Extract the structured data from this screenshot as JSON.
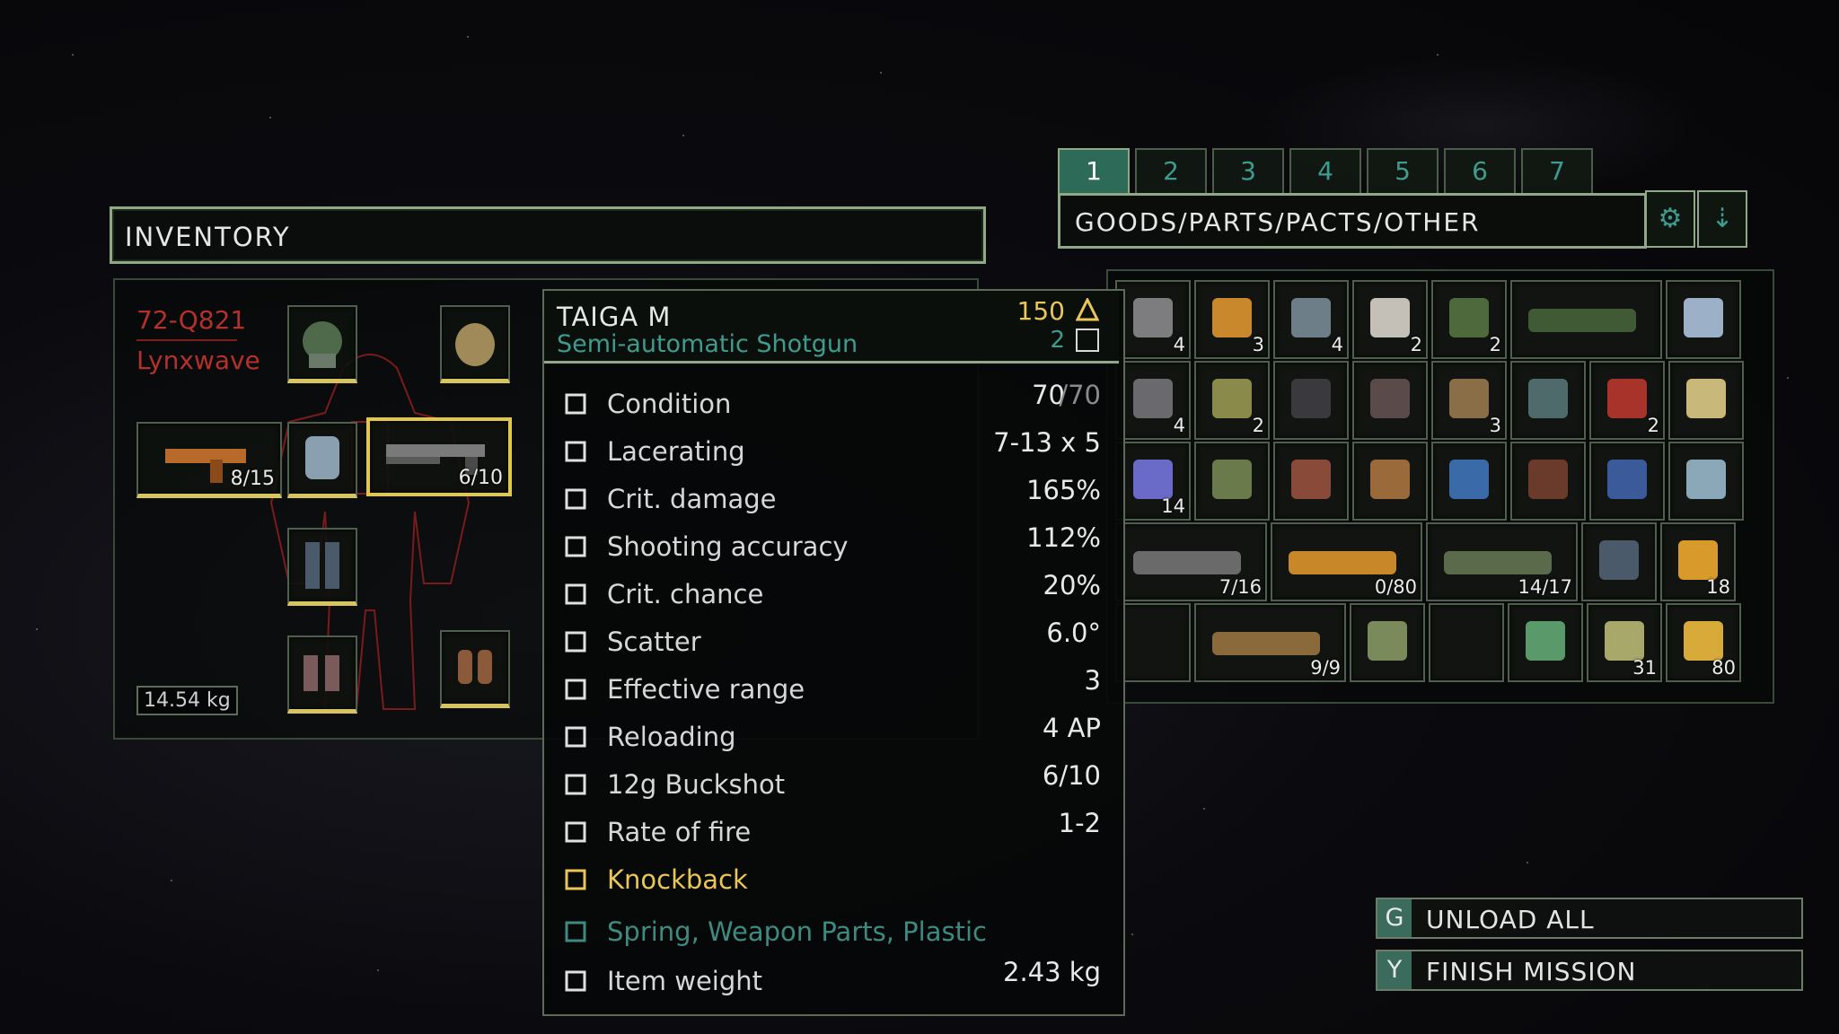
{
  "inventory": {
    "title": "INVENTORY",
    "character_id": "72-Q821",
    "character_name": "Lynxwave",
    "weight": "14.54 kg",
    "slots": {
      "left_weapon_qty": "8/15",
      "right_weapon_qty": "6/10"
    }
  },
  "tooltip": {
    "name": "TAIGA M",
    "type": "Semi-automatic Shotgun",
    "price": "150",
    "count": "2",
    "stats": [
      {
        "icon": "condition-icon",
        "label": "Condition",
        "value": "70",
        "value_suffix": "/70"
      },
      {
        "icon": "lacerating-icon",
        "label": "Lacerating",
        "value": "7-13 x 5"
      },
      {
        "icon": "crit-damage-icon",
        "label": "Crit. damage",
        "value": "165%"
      },
      {
        "icon": "crosshair-icon",
        "label": "Shooting accuracy",
        "value": "112%"
      },
      {
        "icon": "crit-chance-icon",
        "label": "Crit. chance",
        "value": "20%"
      },
      {
        "icon": "scatter-icon",
        "label": "Scatter",
        "value": "6.0°"
      },
      {
        "icon": "range-icon",
        "label": "Effective range",
        "value": "3"
      },
      {
        "icon": "hourglass-icon",
        "label": "Reloading",
        "value": "4 AP"
      },
      {
        "icon": "ammo-icon",
        "label": "12g Buckshot",
        "value": "6/10"
      },
      {
        "icon": "rate-of-fire-icon",
        "label": "Rate of fire",
        "value": "1-2"
      },
      {
        "icon": "knockback-icon",
        "label": "Knockback",
        "value": ""
      },
      {
        "icon": "parts-icon",
        "label": "Spring, Weapon Parts, Plastic",
        "value": ""
      },
      {
        "icon": "weight-icon",
        "label": "Item weight",
        "value": "2.43 kg"
      }
    ],
    "colors": {
      "accent": "#e9c658",
      "teal": "#3f9b8e",
      "knockback": "#e9c658",
      "parts": "#3f8a80"
    }
  },
  "storage": {
    "tabs": [
      "1",
      "2",
      "3",
      "4",
      "5",
      "6",
      "7"
    ],
    "active_tab": "1",
    "title": "GOODS/PARTS/PACTS/OTHER",
    "settings_icon": "gear-icon",
    "sort_icon": "sort-icon",
    "rows": [
      [
        {
          "name": "metal-plate",
          "qty": "4",
          "color": "#7d7d80"
        },
        {
          "name": "ammo-box",
          "qty": "3",
          "color": "#c9882c"
        },
        {
          "name": "scope-part",
          "qty": "4",
          "color": "#6d7e88"
        },
        {
          "name": "medkit",
          "qty": "2",
          "color": "#c4c0b8"
        },
        {
          "name": "green-crate",
          "qty": "2",
          "color": "#4e6a3c"
        },
        {
          "name": "green-container",
          "qty": "",
          "color": "#3f5a34",
          "wide": true
        },
        {
          "name": "keycard",
          "qty": "",
          "color": "#9cb0c8"
        }
      ],
      [
        {
          "name": "gear-parts",
          "qty": "4",
          "color": "#6a6a6e"
        },
        {
          "name": "battery",
          "qty": "2",
          "color": "#8a8a4a"
        },
        {
          "name": "coal",
          "qty": "",
          "color": "#3a3a3e"
        },
        {
          "name": "metal-box",
          "qty": "",
          "color": "#5a4a4a"
        },
        {
          "name": "wood-scraps",
          "qty": "3",
          "color": "#8a6e48"
        },
        {
          "name": "lantern-box",
          "qty": "",
          "color": "#4e6a6a"
        },
        {
          "name": "red-device",
          "qty": "2",
          "color": "#a8332a"
        },
        {
          "name": "syringe",
          "qty": "",
          "color": "#c8b87a"
        }
      ],
      [
        {
          "name": "cloth",
          "qty": "14",
          "color": "#6a6ac8"
        },
        {
          "name": "spring-coil",
          "qty": "",
          "color": "#6a7a4a"
        },
        {
          "name": "ore-bucket",
          "qty": "",
          "color": "#8a4a3a"
        },
        {
          "name": "wooden-crate",
          "qty": "",
          "color": "#9a6a3a"
        },
        {
          "name": "blue-box",
          "qty": "",
          "color": "#3a6aa8"
        },
        {
          "name": "organic-matter",
          "qty": "",
          "color": "#6a3a2a"
        },
        {
          "name": "blue-armor",
          "qty": "",
          "color": "#3a5a9a"
        },
        {
          "name": "white-armor",
          "qty": "",
          "color": "#8aa8b8"
        }
      ],
      [
        {
          "name": "rifle",
          "qty": "7/16",
          "color": "#6a6a6a",
          "wide": true
        },
        {
          "name": "heavy-gun",
          "qty": "0/80",
          "color": "#c8882a",
          "wide": true
        },
        {
          "name": "pistol",
          "qty": "14/17",
          "color": "#5a6a4a",
          "wide": true
        },
        {
          "name": "vest",
          "qty": "",
          "color": "#4a5a6a"
        },
        {
          "name": "cartridges",
          "qty": "18",
          "color": "#d89a2a"
        }
      ],
      [
        {
          "name": "empty",
          "qty": "",
          "color": ""
        },
        {
          "name": "shotgun",
          "qty": "9/9",
          "color": "#8a6a3a",
          "wide": true
        },
        {
          "name": "canister",
          "qty": "",
          "color": "#7a8a5a"
        },
        {
          "name": "empty",
          "qty": "",
          "color": ""
        },
        {
          "name": "cash",
          "qty": "",
          "color": "#5a9a6a"
        },
        {
          "name": "bullets-green",
          "qty": "31",
          "color": "#a8a86a"
        },
        {
          "name": "bullets-gold",
          "qty": "80",
          "color": "#d8aa3a"
        }
      ]
    ]
  },
  "actions": [
    {
      "key": "G",
      "label": "UNLOAD ALL"
    },
    {
      "key": "Y",
      "label": "FINISH MISSION"
    }
  ]
}
